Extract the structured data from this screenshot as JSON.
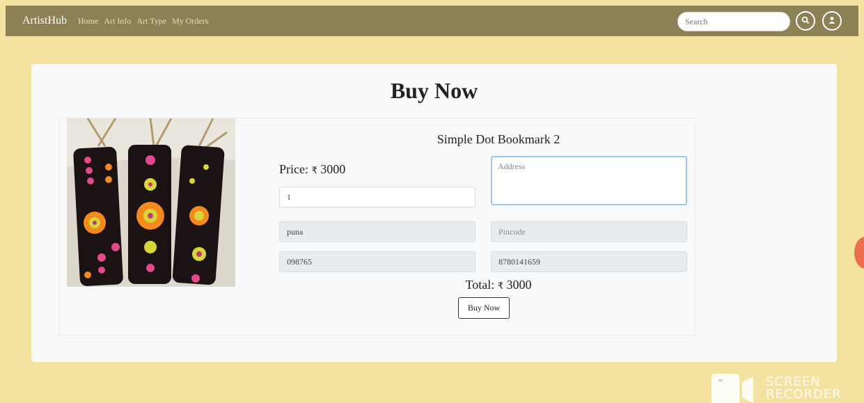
{
  "nav": {
    "brand": "ArtistHub",
    "links": [
      "Home",
      "Art Info",
      "Art Type",
      "My Orders"
    ],
    "search_placeholder": "Search",
    "icons": [
      "search-icon",
      "user-icon"
    ]
  },
  "page": {
    "title": "Buy Now"
  },
  "product": {
    "name": "Simple Dot Bookmark 2",
    "price_label": "Price:",
    "currency": "₹",
    "price": "3000"
  },
  "form": {
    "quantity": "1",
    "address_placeholder": "Address",
    "city": "puna",
    "pincode_placeholder": "Pincode",
    "zip": "098765",
    "phone": "8780141659"
  },
  "summary": {
    "total_label": "Total:",
    "currency": "₹",
    "total": "3000",
    "buy_button": "Buy Now"
  },
  "watermark": {
    "line1": "SCREEN",
    "line2": "RECORDER"
  },
  "colors": {
    "navbar": "#8c8155",
    "background": "#f3e2a0",
    "card": "#f8f9fa"
  }
}
